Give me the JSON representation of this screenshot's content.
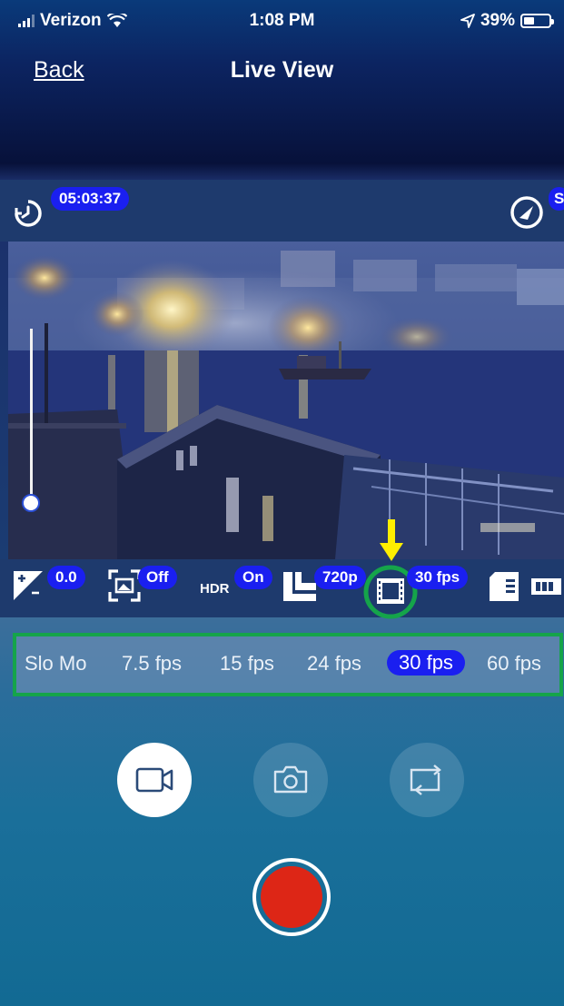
{
  "status_bar": {
    "carrier": "Verizon",
    "time": "1:08 PM",
    "battery_percent": "39%",
    "icons": [
      "signal-icon",
      "wifi-icon",
      "location-arrow-icon",
      "battery-icon"
    ]
  },
  "nav": {
    "back_label": "Back",
    "title": "Live View"
  },
  "timer": {
    "value": "05:03:37",
    "right_badge": "S"
  },
  "exposure_slider": {
    "level": 0.05
  },
  "settings": {
    "ev": "0.0",
    "protune": "Off",
    "hdr_label": "HDR",
    "hdr": "On",
    "resolution": "720p",
    "fps": "30 fps"
  },
  "fps_options": {
    "items": [
      "Slo Mo",
      "7.5 fps",
      "15 fps",
      "24 fps",
      "30 fps",
      "60 fps"
    ],
    "selected": "30 fps"
  },
  "colors": {
    "pill_blue": "#1a1ff0",
    "highlight_green": "#15a44a",
    "arrow_yellow": "#ffef00",
    "record_red": "#dd2616"
  },
  "mode_buttons": [
    "video-camera-icon",
    "photo-camera-icon",
    "flip-camera-icon"
  ]
}
